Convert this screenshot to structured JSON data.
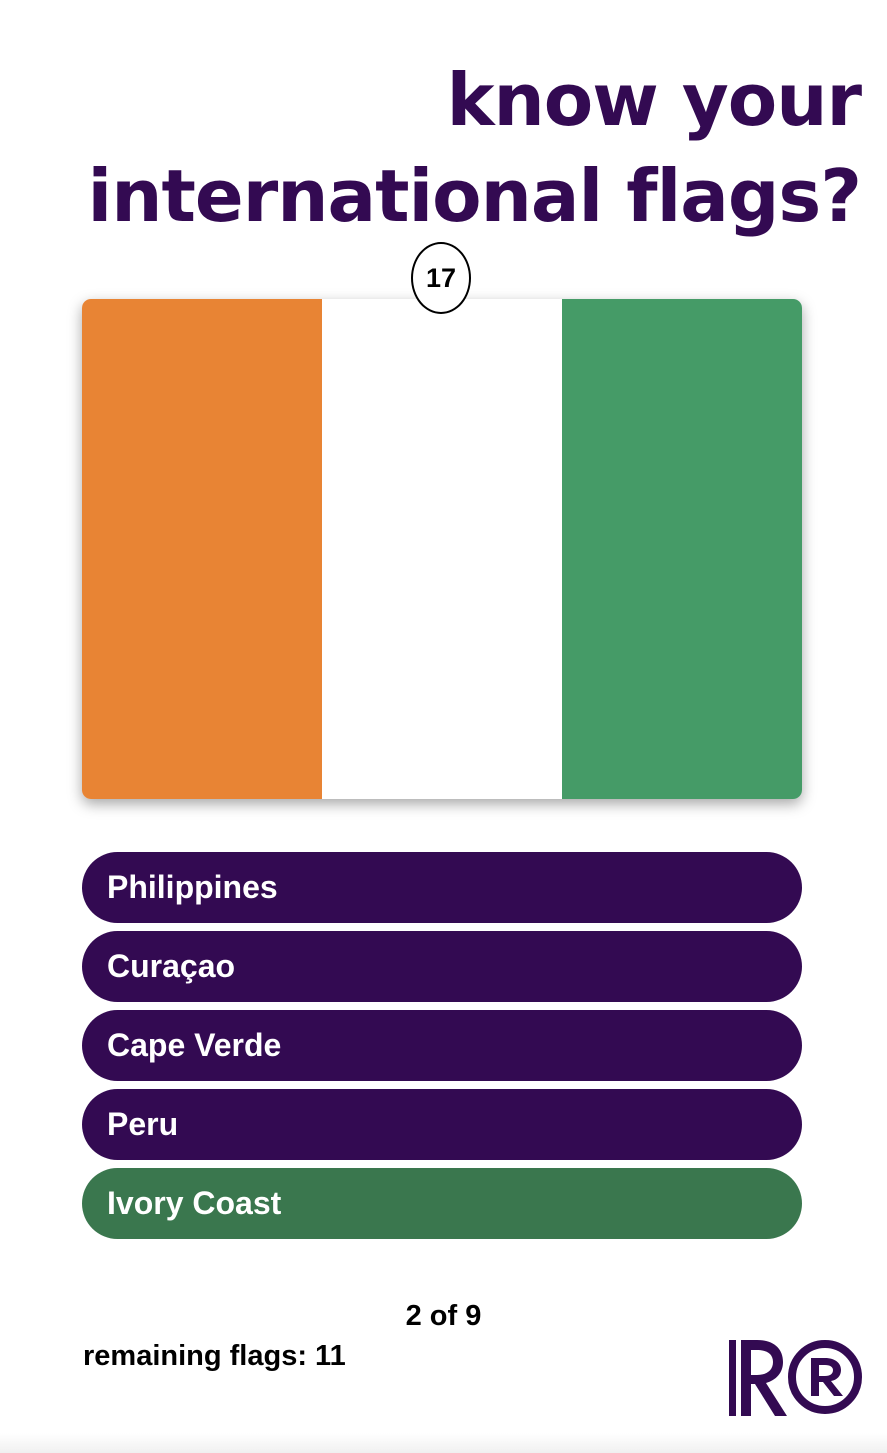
{
  "header": {
    "title_line1": "know your",
    "title_line2": "international flags?"
  },
  "timer": {
    "value": "17"
  },
  "flag": {
    "stripes": [
      "#e88434",
      "#ffffff",
      "#459b67"
    ]
  },
  "answers": [
    {
      "label": "Philippines",
      "state": "default"
    },
    {
      "label": "Curaçao",
      "state": "default"
    },
    {
      "label": "Cape Verde",
      "state": "default"
    },
    {
      "label": "Peru",
      "state": "default"
    },
    {
      "label": "Ivory Coast",
      "state": "correct"
    }
  ],
  "footer": {
    "progress": "2 of 9",
    "remaining": "remaining flags: 11"
  },
  "colors": {
    "brand": "#330a52",
    "correct": "#3a774e"
  },
  "logo": {
    "icon": "r-registered-logo"
  }
}
